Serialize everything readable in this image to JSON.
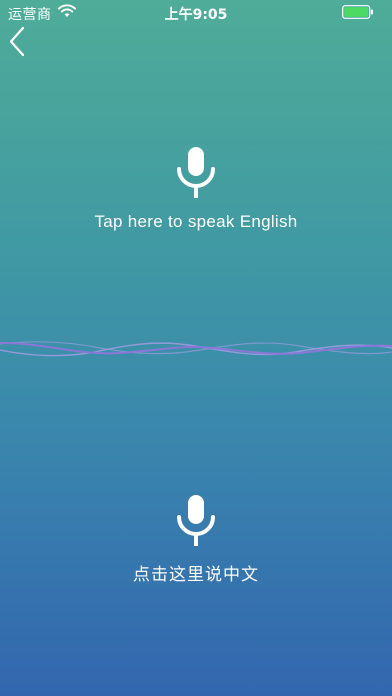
{
  "status_bar": {
    "carrier": "运营商",
    "time": "上午9:05",
    "battery_color": "#4cd964"
  },
  "nav": {
    "back_icon": "chevron-left-icon"
  },
  "english_panel": {
    "icon": "microphone-icon",
    "label": "Tap here to speak English"
  },
  "chinese_panel": {
    "icon": "microphone-icon",
    "label": "点击这里说中文"
  },
  "wave": {
    "primary_color": "#8a78d6",
    "secondary_color": "#a99ee6"
  },
  "theme": {
    "gradient_top": "#4fac98",
    "gradient_bottom": "#3366af"
  }
}
